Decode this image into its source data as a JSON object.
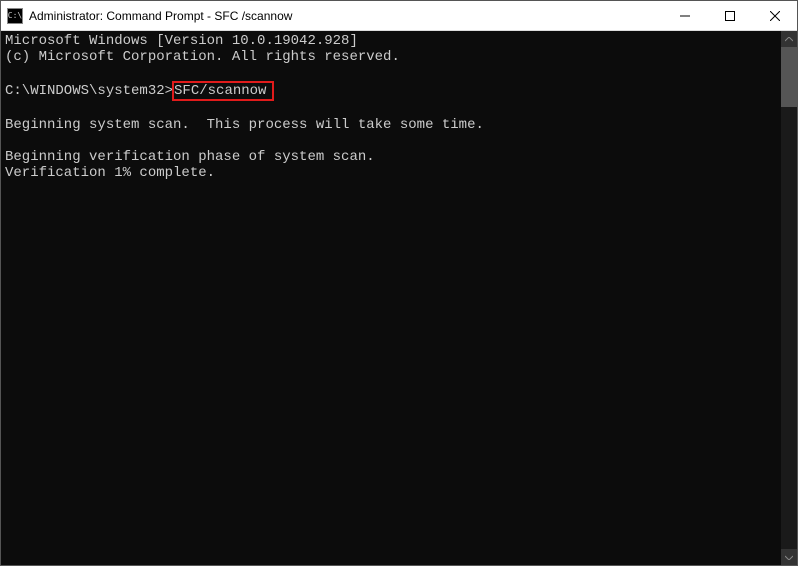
{
  "titlebar": {
    "icon_glyph": "C:\\",
    "title": "Administrator: Command Prompt - SFC /scannow"
  },
  "terminal": {
    "line1": "Microsoft Windows [Version 10.0.19042.928]",
    "line2": "(c) Microsoft Corporation. All rights reserved.",
    "blank1": "",
    "prompt_prefix": "C:\\WINDOWS\\system32>",
    "prompt_command": "SFC/scannow",
    "blank2": "",
    "line3": "Beginning system scan.  This process will take some time.",
    "blank3": "",
    "line4": "Beginning verification phase of system scan.",
    "line5": "Verification 1% complete."
  }
}
